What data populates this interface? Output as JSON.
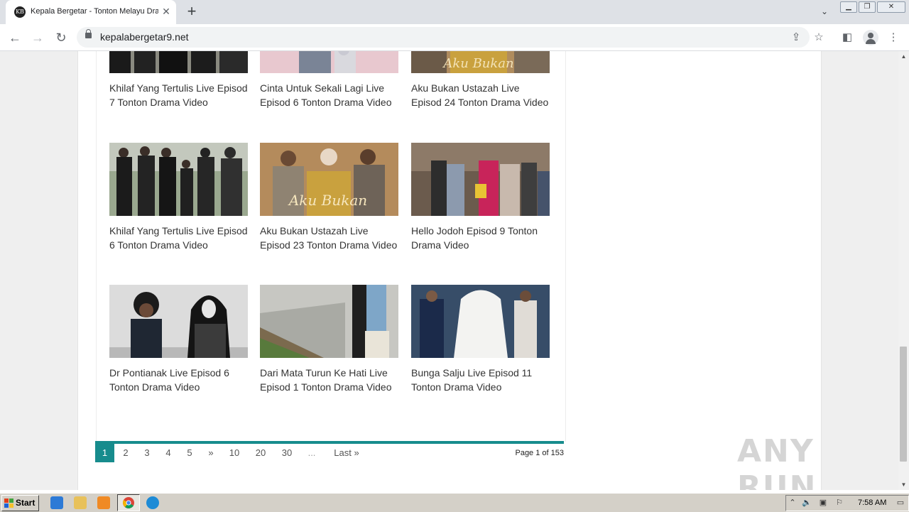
{
  "browser": {
    "tab_title": "Kepala Bergetar - Tonton Melayu Drama",
    "favicon_text": "KB",
    "url": "kepalabergetar9.net"
  },
  "cards": [
    {
      "title": "Khilaf Yang Tertulis Live Episod 7 Tonton Drama Video"
    },
    {
      "title": "Cinta Untuk Sekali Lagi Live Episod 6 Tonton Drama Video"
    },
    {
      "title": "Aku Bukan Ustazah Live Episod 24 Tonton Drama Video"
    },
    {
      "title": "Khilaf Yang Tertulis Live Episod 6 Tonton Drama Video"
    },
    {
      "title": "Aku Bukan Ustazah Live Episod 23 Tonton Drama Video"
    },
    {
      "title": "Hello Jodoh Episod 9 Tonton Drama Video"
    },
    {
      "title": "Dr Pontianak Live Episod 6 Tonton Drama Video"
    },
    {
      "title": "Dari Mata Turun Ke Hati Live Episod 1 Tonton Drama Video"
    },
    {
      "title": "Bunga Salju Live Episod 11 Tonton Drama Video"
    }
  ],
  "thumb_text": {
    "aku_bukan": "Aku Bukan"
  },
  "pagination": {
    "pages": [
      "1",
      "2",
      "3",
      "4",
      "5",
      "»",
      "10",
      "20",
      "30",
      "...",
      "Last »"
    ],
    "info": "Page 1 of 153"
  },
  "watermark": "ANY RUN",
  "taskbar": {
    "start_label": "Start",
    "clock": "7:58 AM"
  },
  "colors": {
    "accent": "#178c8d"
  }
}
